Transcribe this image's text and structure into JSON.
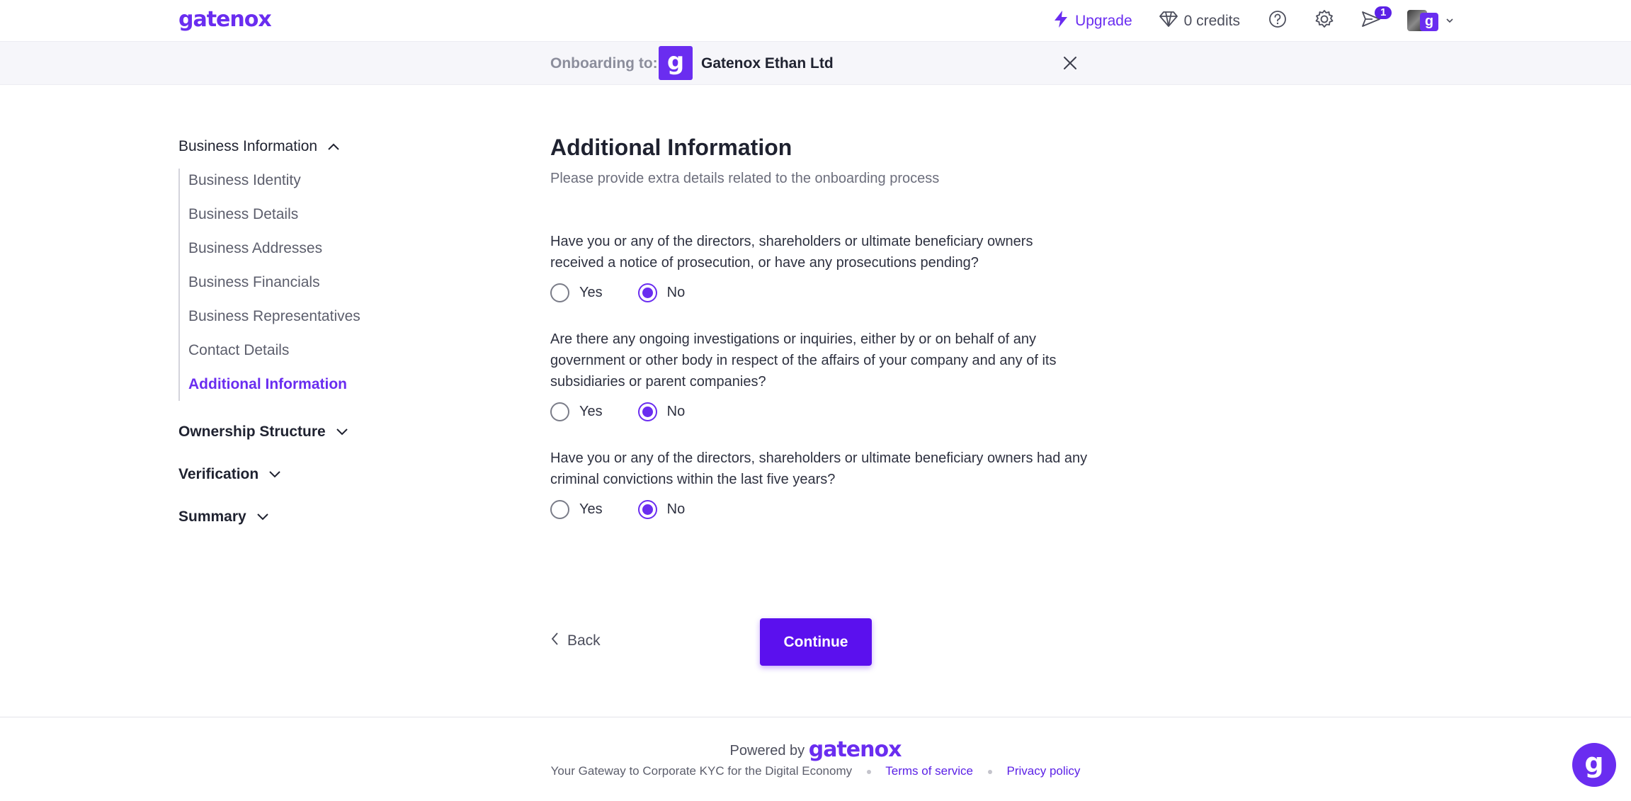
{
  "app": {
    "logo_text": "gatenox",
    "accent_color": "#6a2df0"
  },
  "topbar": {
    "upgrade_label": "Upgrade",
    "credits_label": "0 credits",
    "notification_count": "1",
    "avatar_letter": "g"
  },
  "onboarding": {
    "label": "Onboarding to:",
    "logo_letter": "g",
    "company_name": "Gatenox Ethan Ltd"
  },
  "sidebar": {
    "business_information": "Business Information",
    "items": [
      "Business Identity",
      "Business Details",
      "Business Addresses",
      "Business Financials",
      "Business Representatives",
      "Contact Details",
      "Additional Information"
    ],
    "active_item": "Additional Information",
    "ownership_structure": "Ownership Structure",
    "verification": "Verification",
    "summary": "Summary"
  },
  "main": {
    "title": "Additional Information",
    "subtitle": "Please provide extra details related to the onboarding process",
    "questions": [
      {
        "text": "Have you or any of the directors, shareholders or ultimate beneficiary owners received a notice of prosecution, or have any prosecutions pending?",
        "selected": "No"
      },
      {
        "text": "Are there any ongoing investigations or inquiries, either by or on behalf of any government or other body in respect of the affairs of your company and any of its subsidiaries or parent companies?",
        "selected": "No"
      },
      {
        "text": "Have you or any of the directors, shareholders or ultimate beneficiary owners had any criminal convictions within the last five years?",
        "selected": "No"
      }
    ],
    "yes_label": "Yes",
    "no_label": "No"
  },
  "actions": {
    "back_label": "Back",
    "continue_label": "Continue"
  },
  "footer": {
    "powered_by": "Powered by",
    "brand": "gatenox",
    "tagline": "Your Gateway to Corporate KYC for the Digital Economy",
    "terms": "Terms of service",
    "privacy": "Privacy policy"
  },
  "chat": {
    "letter": "g"
  }
}
